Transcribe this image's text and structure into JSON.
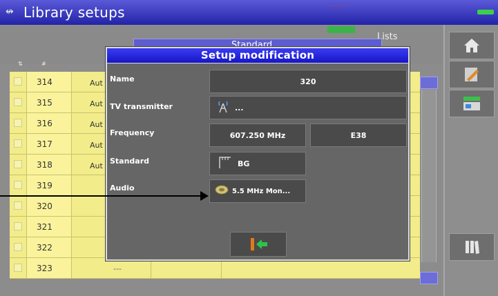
{
  "titlebar": {
    "title": "Library setups",
    "status_red": "— — —"
  },
  "background": {
    "tab_label": "Standard",
    "lists_label": "Lists",
    "rows": [
      {
        "num": "314",
        "aut": "Aut",
        "dash": ""
      },
      {
        "num": "315",
        "aut": "Aut",
        "dash": ""
      },
      {
        "num": "316",
        "aut": "Aut",
        "dash": ""
      },
      {
        "num": "317",
        "aut": "Aut",
        "dash": ""
      },
      {
        "num": "318",
        "aut": "Aut",
        "dash": ""
      },
      {
        "num": "319",
        "aut": "",
        "dash": "..."
      },
      {
        "num": "320",
        "aut": "",
        "dash": "..."
      },
      {
        "num": "321",
        "aut": "",
        "dash": "..."
      },
      {
        "num": "322",
        "aut": "",
        "dash": "..."
      },
      {
        "num": "323",
        "aut": "",
        "dash": "---"
      }
    ]
  },
  "dialog": {
    "title": "Setup modification",
    "name_label": "Name",
    "name_value": "320",
    "tv_label": "TV transmitter",
    "tv_value": "...",
    "freq_label": "Frequency",
    "freq_value": "607.250 MHz",
    "channel_value": "E38",
    "std_label": "Standard",
    "std_value": "BG",
    "audio_label": "Audio",
    "audio_value": "5.5 MHz Mon..."
  },
  "sidebar": {
    "icons": [
      "home-icon",
      "edit-icon",
      "import-icon",
      "books-icon"
    ]
  },
  "colors": {
    "accent": "#2323a8",
    "row": "#f2ec8a",
    "dialog": "#666666",
    "ok_green": "#2cc44c",
    "ok_orange": "#e07a1c"
  }
}
